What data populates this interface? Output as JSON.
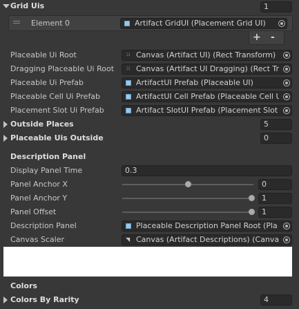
{
  "grid_uis": {
    "label": "Grid Uis",
    "count": "1",
    "element_label": "Element 0",
    "element_value": "Artifact GridUI (Placement Grid UI)",
    "add_label": "+",
    "remove_label": "-"
  },
  "refs": [
    {
      "label": "Placeable Ui Root",
      "value": "Canvas (Artifact UI) (Rect Transform)",
      "icon": "rect-transform-icon"
    },
    {
      "label": "Dragging Placeable Ui Root",
      "value": "Canvas (Artifact UI Dragging) (Rect Tr",
      "icon": "rect-transform-icon"
    },
    {
      "label": "Placeable Ui Prefab",
      "value": "ArtifactUI Prefab (Placeable UI)",
      "icon": "prefab-icon"
    },
    {
      "label": "Placeable Cell Ui Prefab",
      "value": "ArtifactUI Cell Prefab (Placeable Cell U",
      "icon": "prefab-icon"
    },
    {
      "label": "Placement Slot Ui Prefab",
      "value": "Artifact SlotUI Prefab (Placement Slot",
      "icon": "prefab-icon"
    }
  ],
  "outside_places": {
    "label": "Outside Places",
    "value": "5"
  },
  "placeable_uis_outside": {
    "label": "Placeable Uis Outside",
    "value": "0"
  },
  "description_panel": {
    "header": "Description Panel",
    "display_panel_time": {
      "label": "Display Panel Time",
      "value": "0.3"
    },
    "panel_anchor_x": {
      "label": "Panel Anchor X",
      "value": "0",
      "fraction": 0
    },
    "panel_anchor_y": {
      "label": "Panel Anchor Y",
      "value": "1",
      "fraction": 1
    },
    "panel_offset": {
      "label": "Panel Offset",
      "value": "1",
      "fraction": 1
    },
    "description_panel": {
      "label": "Description Panel",
      "value": "Placeable Description Panel Root (Pla"
    },
    "canvas_scaler": {
      "label": "Canvas Scaler",
      "value": "Canvas (Artifact Descriptions) (Canva"
    }
  },
  "colors": {
    "header": "Colors",
    "colors_by_rarity": {
      "label": "Colors By Rarity",
      "value": "4"
    }
  }
}
